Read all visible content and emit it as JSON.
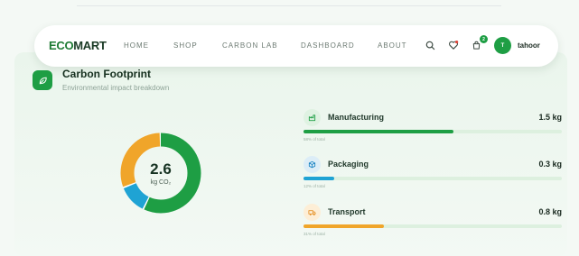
{
  "nav": {
    "logo_eco": "ECO",
    "logo_mart": "MART",
    "links": [
      "HOME",
      "SHOP",
      "CARBON LAB",
      "DASHBOARD",
      "ABOUT"
    ],
    "cart_count": "2",
    "avatar_initial": "T",
    "username": "tahoor",
    "icons": [
      "search-icon",
      "heart-icon",
      "cart-icon"
    ]
  },
  "section": {
    "title": "Carbon Footprint",
    "subtitle": "Environmental impact breakdown",
    "icon": "leaf-icon"
  },
  "total": {
    "value": "2.6",
    "unit": "kg CO₂"
  },
  "items": [
    {
      "label": "Manufacturing",
      "value": "1.5 kg",
      "share": 0.58,
      "share_text": "58% of total",
      "color": "#1e9e44",
      "icon_bg": "#dff2e2",
      "icon_color": "#1e9e44",
      "icon": "factory-icon"
    },
    {
      "label": "Packaging",
      "value": "0.3 kg",
      "share": 0.12,
      "share_text": "12% of total",
      "color": "#1fa3d4",
      "icon_bg": "#dcedf7",
      "icon_color": "#1f86c4",
      "icon": "box-icon"
    },
    {
      "label": "Transport",
      "value": "0.8 kg",
      "share": 0.31,
      "share_text": "31% of total",
      "color": "#f0a52a",
      "icon_bg": "#fdeed6",
      "icon_color": "#e5932a",
      "icon": "truck-icon"
    }
  ],
  "colors": {
    "brand": "#1e9e44",
    "accent_blue": "#1fa3d4",
    "accent_orange": "#f0a52a"
  }
}
